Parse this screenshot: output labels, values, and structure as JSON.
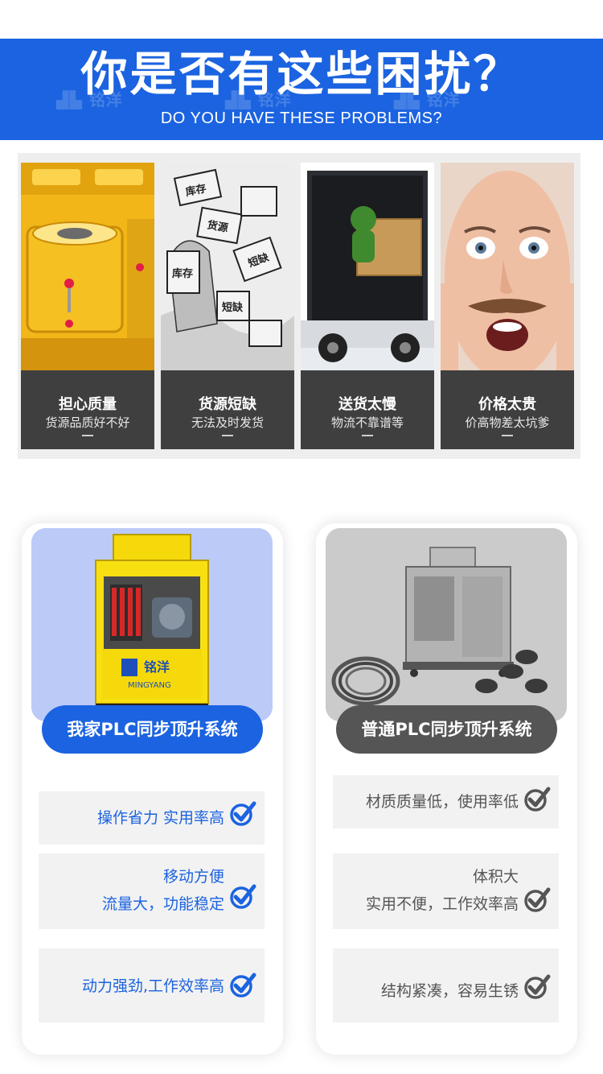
{
  "header": {
    "title": "你是否有这些困扰？",
    "subtitle": "DO YOU HAVE THESE PROBLEMS?",
    "watermark": "铭洋 MINGYANG"
  },
  "problems": [
    {
      "title": "担心质量",
      "desc": "货源品质好不好"
    },
    {
      "title": "货源短缺",
      "desc": "无法及时发货"
    },
    {
      "title": "送货太慢",
      "desc": "物流不靠谱等"
    },
    {
      "title": "价格太贵",
      "desc": "价高物差太坑爹"
    }
  ],
  "illustration_labels": {
    "box1": "库存",
    "box2": "货源",
    "box3": "短缺",
    "box4": "库存",
    "box5": "短缺",
    "logo_cn": "铭洋",
    "logo_en": "MINGYANG"
  },
  "comparison": {
    "ours": {
      "label": "我家PLC同步顶升系统",
      "features": [
        {
          "lines": [
            "操作省力 实用率高"
          ]
        },
        {
          "lines": [
            "移动方便",
            "流量大，功能稳定"
          ]
        },
        {
          "lines": [
            "动力强劲,工作效率高"
          ]
        }
      ]
    },
    "theirs": {
      "label": "普通PLC同步顶升系统",
      "features": [
        {
          "lines": [
            "材质质量低，使用率低"
          ]
        },
        {
          "lines": [
            "体积大",
            "实用不便，工作效率高"
          ]
        },
        {
          "lines": [
            "结构紧凑，容易生锈"
          ]
        }
      ]
    }
  },
  "colors": {
    "brand_blue": "#1b63e0",
    "dark_gray": "#3f3f3f",
    "pill_gray": "#555555",
    "text_blue": "#1b63e0",
    "text_gray": "#555555"
  },
  "icons": {
    "check": "check-circle-icon"
  }
}
